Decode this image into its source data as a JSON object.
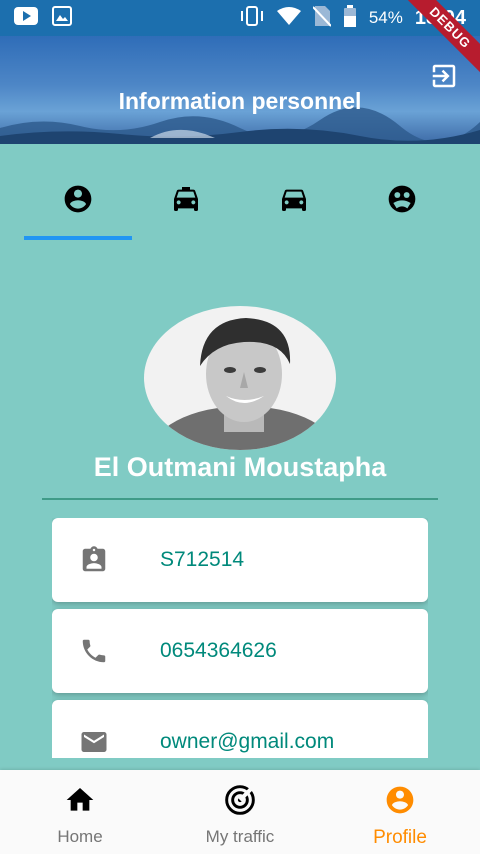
{
  "status_bar": {
    "battery": "54%",
    "time": "18:04",
    "left_icons": [
      "youtube-icon",
      "image-icon"
    ],
    "right_icons": [
      "vibrate-icon",
      "wifi-icon",
      "no-sim-icon",
      "battery-icon"
    ]
  },
  "debug_banner": "DEBUG",
  "header": {
    "title": "Information personnel",
    "action_icon": "logout-icon"
  },
  "tabs": [
    {
      "icon": "account-circle-icon",
      "active": true
    },
    {
      "icon": "taxi-icon",
      "active": false
    },
    {
      "icon": "car-icon",
      "active": false
    },
    {
      "icon": "face-icon",
      "active": false
    }
  ],
  "profile": {
    "name": "El Outmani Moustapha"
  },
  "info": [
    {
      "icon": "id-badge-icon",
      "value": "S712514"
    },
    {
      "icon": "phone-icon",
      "value": "0654364626"
    },
    {
      "icon": "email-icon",
      "value": "owner@gmail.com"
    }
  ],
  "bottom_nav": {
    "items": [
      {
        "label": "Home",
        "icon": "home-icon"
      },
      {
        "label": "My traffic",
        "icon": "radar-icon"
      },
      {
        "label": "Profile",
        "icon": "account-circle-icon"
      }
    ],
    "active_index": 2
  },
  "colors": {
    "background": "#80CBC4",
    "accent": "#2196F3",
    "active_nav": "#FF8C00",
    "info_text": "#00897B"
  }
}
